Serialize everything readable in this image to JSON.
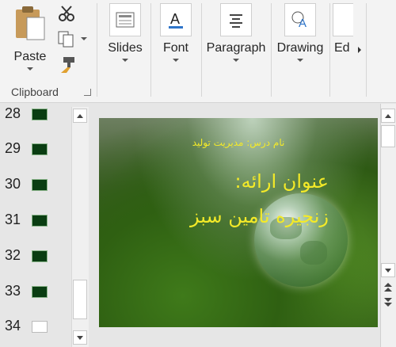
{
  "ribbon": {
    "clipboard": {
      "paste_label": "Paste",
      "group_label": "Clipboard"
    },
    "buttons": [
      {
        "label": "Slides"
      },
      {
        "label": "Font"
      },
      {
        "label": "Paragraph"
      },
      {
        "label": "Drawing"
      },
      {
        "label": "Ed"
      }
    ]
  },
  "slide_panel": {
    "slides": [
      {
        "number": "28"
      },
      {
        "number": "29"
      },
      {
        "number": "30"
      },
      {
        "number": "31"
      },
      {
        "number": "32"
      },
      {
        "number": "33"
      },
      {
        "number": "34"
      }
    ]
  },
  "slide": {
    "course_line": "نام درس: مدیریت تولید",
    "title_line1": "عنوان ارائه:",
    "title_line2": "زنجیره تامین سبز"
  }
}
